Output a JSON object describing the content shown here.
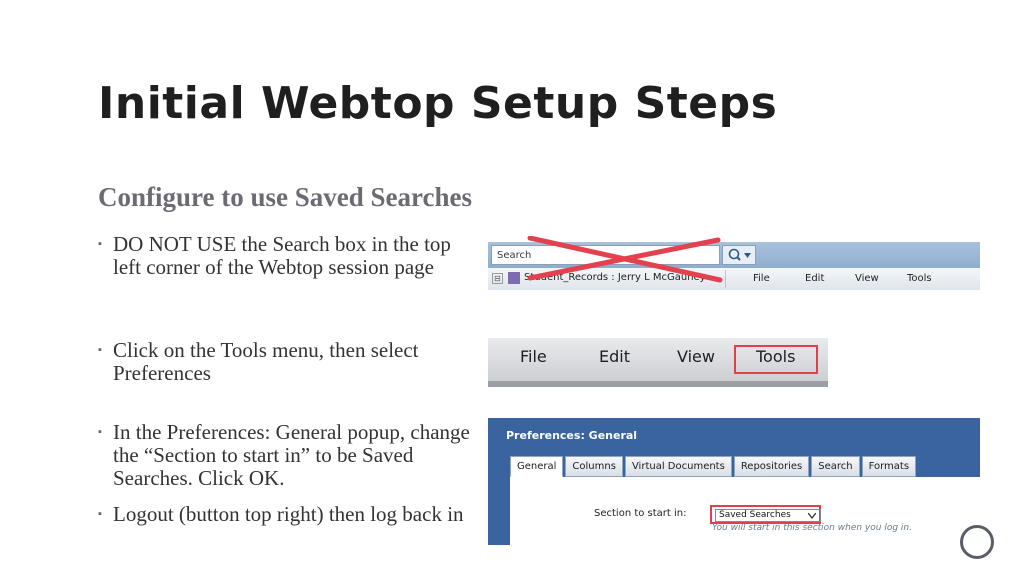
{
  "slide": {
    "title": "Initial Webtop Setup Steps",
    "subtitle": "Configure to use Saved Searches",
    "bullets": [
      {
        "text": "DO NOT USE the Search box in the top left corner of the Webtop session page"
      },
      {
        "text": "Click on the Tools menu, then select Preferences"
      },
      {
        "text": "In the Preferences: General popup, change the “Section to start in” to be Saved Searches.  Click OK."
      },
      {
        "text": "Logout (button top right) then log back in"
      }
    ],
    "bullet_mark": "▪"
  },
  "screenshot1": {
    "search_label": "Search",
    "record_label": "Student_Records : Jerry L McGauhey",
    "menu": [
      "File",
      "Edit",
      "View",
      "Tools"
    ],
    "expand": "⊟"
  },
  "screenshot2": {
    "menu": [
      "File",
      "Edit",
      "View",
      "Tools"
    ]
  },
  "screenshot3": {
    "header": "Preferences: General",
    "tabs": [
      "General",
      "Columns",
      "Virtual Documents",
      "Repositories",
      "Search",
      "Formats"
    ],
    "section_label": "Section to start in:",
    "section_value": "Saved Searches",
    "hint": "You will start in this section when you log in."
  },
  "colors": {
    "highlight_red": "#e0404a",
    "dialog_blue": "#3a64a0"
  }
}
